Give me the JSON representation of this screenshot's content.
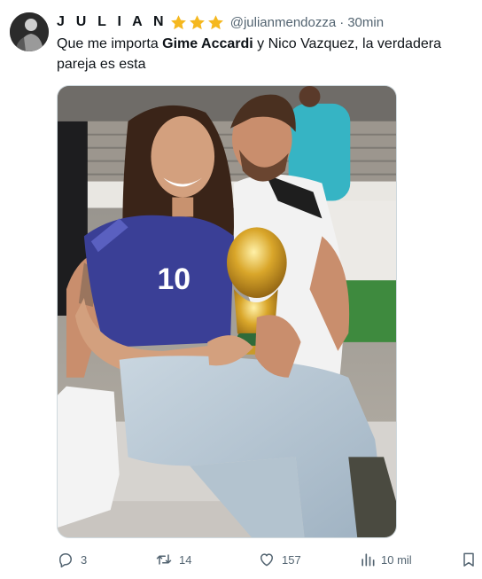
{
  "tweet": {
    "display_name": "J U L I A N",
    "handle": "@julianmendozza",
    "separator": "·",
    "time": "30min",
    "badge": {
      "icon": "star-icon",
      "count": 3,
      "color": "#f5b81f"
    },
    "text": {
      "part1": "Que me importa ",
      "bold": "Gime Accardi",
      "part2": " y Nico Vazquez, la verdadera pareja es esta"
    }
  },
  "media": {
    "icon": "photo",
    "shirt_number": "10"
  },
  "actions": {
    "reply": {
      "icon": "reply-icon",
      "count": "3"
    },
    "retweet": {
      "icon": "retweet-icon",
      "count": "14"
    },
    "like": {
      "icon": "heart-icon",
      "count": "157"
    },
    "views": {
      "icon": "views-icon",
      "count": "10 mil"
    },
    "bookmark": {
      "icon": "bookmark-icon"
    }
  },
  "colors": {
    "text": "#0f1419",
    "muted": "#536471",
    "star": "#f5b81f",
    "border": "#cfd9de"
  }
}
